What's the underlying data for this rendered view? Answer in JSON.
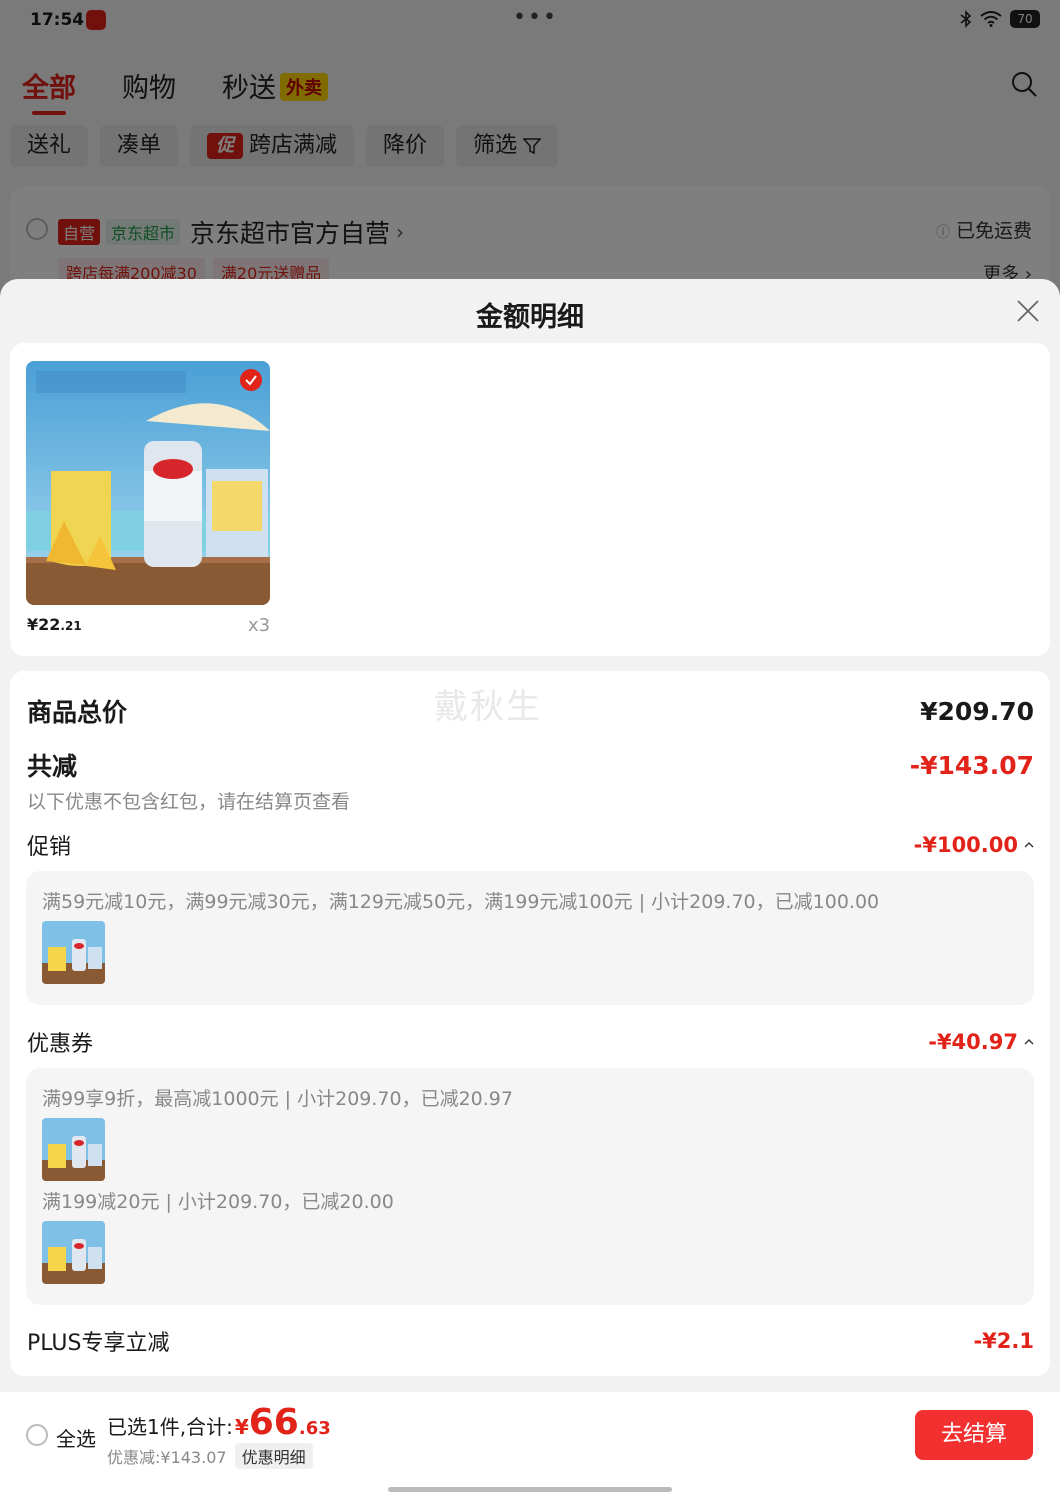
{
  "status_bar": {
    "time": "17:54",
    "dots": "•••",
    "battery": "70"
  },
  "top_tabs": [
    {
      "label": "全部"
    },
    {
      "label": "购物"
    },
    {
      "label": "秒送",
      "badge": "外卖"
    }
  ],
  "filters": [
    {
      "label": "送礼"
    },
    {
      "label": "凑单"
    },
    {
      "label": "跨店满减",
      "badge": "促"
    },
    {
      "label": "降价"
    },
    {
      "label": "筛选"
    }
  ],
  "store": {
    "tag_self": "自营",
    "tag_market": "京东超市",
    "name": "京东超市官方自营",
    "shipping": "已免运费",
    "promo_tags": [
      "跨店每满200减30",
      "满20元送赠品"
    ],
    "more": "更多"
  },
  "sheet": {
    "title": "金额明细",
    "product": {
      "price_int": "¥22",
      "price_dec": ".21",
      "qty": "x3"
    },
    "watermark": "戴秋生",
    "total_label": "商品总价",
    "total_value": "¥209.70",
    "discount_label": "共减",
    "discount_value": "-¥143.07",
    "discount_note": "以下优惠不包含红包，请在结算页查看",
    "promo": {
      "label": "促销",
      "value": "-¥100.00",
      "lines": [
        "满59元减10元，满99元减30元，满129元减50元，满199元减100元 | 小计209.70，已减100.00"
      ]
    },
    "coupon": {
      "label": "优惠券",
      "value": "-¥40.97",
      "lines": [
        "满99享9折，最高减1000元 | 小计209.70，已减20.97",
        "满199减20元 | 小计209.70，已减20.00"
      ]
    },
    "plus": {
      "label": "PLUS专享立减",
      "value": "-¥2.1"
    }
  },
  "bottom_bar": {
    "select_all": "全选",
    "selected_text": "已选1件,合计:",
    "currency": "¥",
    "total_int": "66",
    "total_dec": ".63",
    "discount_text": "优惠减:¥143.07",
    "detail_chip": "优惠明细",
    "checkout": "去结算"
  },
  "colors": {
    "accent": "#e2231a",
    "checkout": "#f23030",
    "sheet_bg": "#f2f2f2"
  }
}
